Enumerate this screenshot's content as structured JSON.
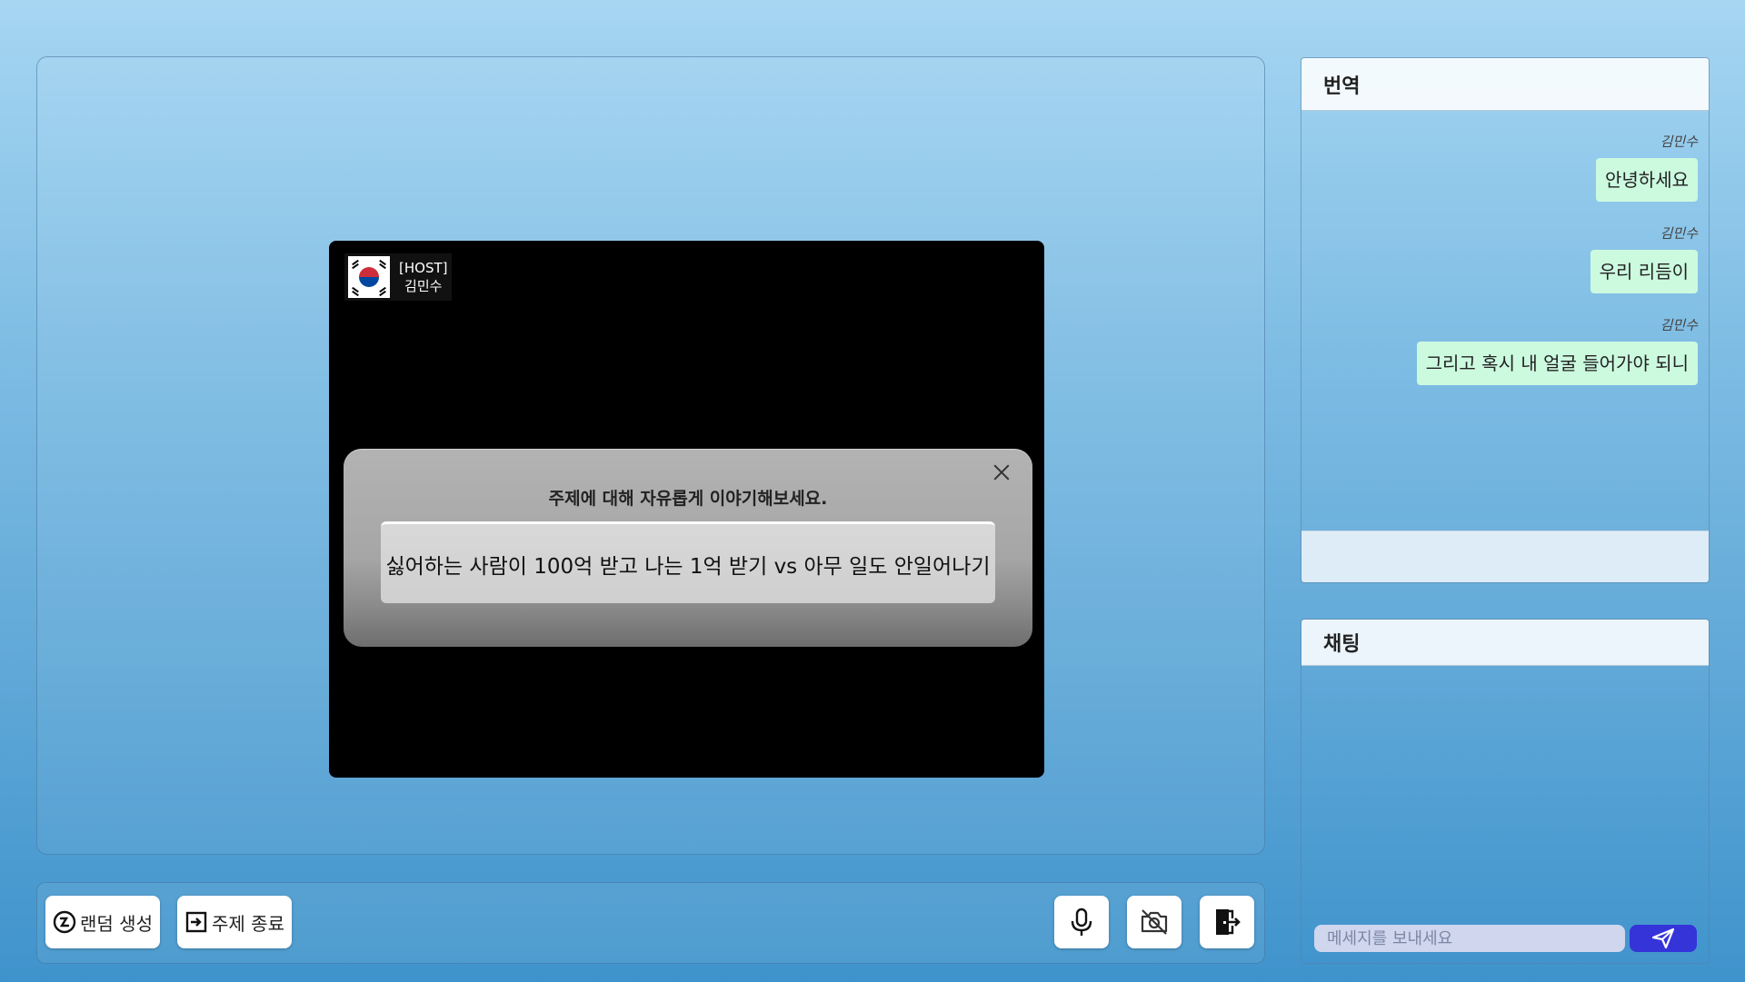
{
  "video": {
    "host_role": "[HOST]",
    "host_name": "김민수",
    "flag": "south-korea-flag-icon"
  },
  "topic_modal": {
    "hint": "주제에 대해 자유롭게 이야기해보세요.",
    "topic": "싫어하는 사람이 100억 받고 나는 1억 받기 vs 아무 일도 안일어나기"
  },
  "toolbar": {
    "random_label": "랜덤 생성",
    "end_topic_label": "주제 종료",
    "random_icon": "refresh-coin-icon",
    "end_icon": "exit-box-icon",
    "mic_icon": "microphone-icon",
    "camera_icon": "camera-off-icon",
    "leave_icon": "door-exit-icon"
  },
  "translation": {
    "title": "번역",
    "messages": [
      {
        "author": "김민수",
        "text": "안녕하세요"
      },
      {
        "author": "김민수",
        "text": "우리 리듬이"
      },
      {
        "author": "김민수",
        "text": "그리고 혹시 내 얼굴 들어가야 되니"
      }
    ]
  },
  "chat": {
    "title": "채팅",
    "placeholder": "메세지를 보내세요",
    "send_icon": "send-icon"
  },
  "colors": {
    "bubble": "#ccfadf",
    "send_button": "#3434d9",
    "input": "#cfd6ee"
  }
}
